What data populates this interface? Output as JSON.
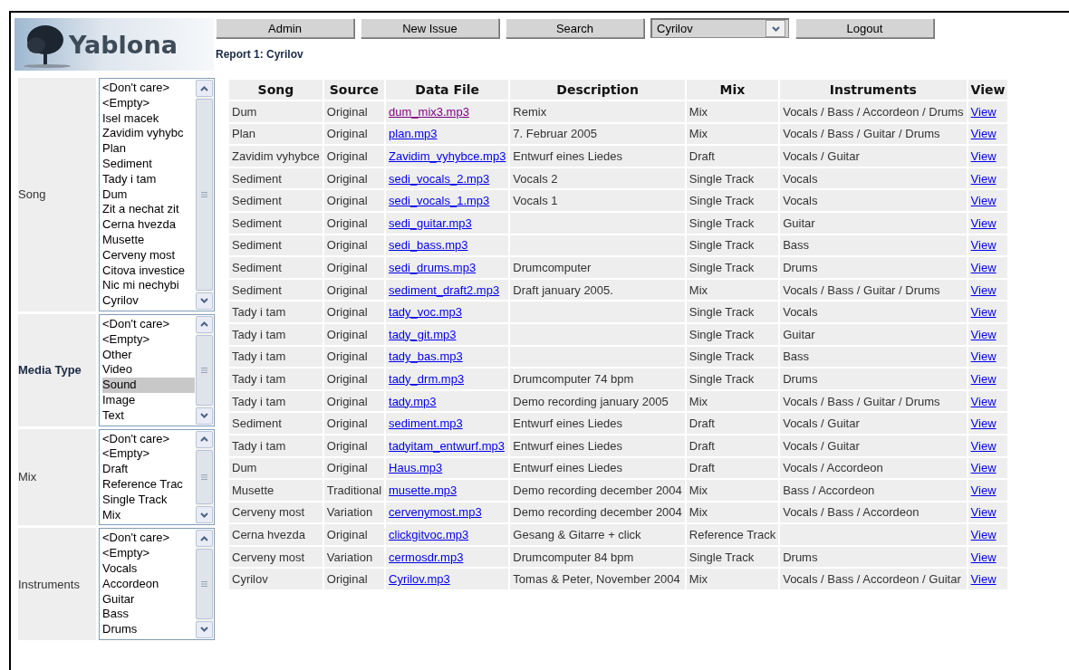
{
  "logo": {
    "text": "Yablona"
  },
  "nav": {
    "buttons": [
      "Admin",
      "New Issue",
      "Search"
    ],
    "user_select": {
      "value": "Cyrilov"
    },
    "logout": "Logout"
  },
  "report_title": "Report 1: Cyrilov",
  "filters": [
    {
      "label": "Song",
      "bold": false,
      "items": [
        {
          "text": "<Don't care>",
          "selected": false
        },
        {
          "text": "<Empty>",
          "selected": false
        },
        {
          "text": "Isel macek",
          "selected": false
        },
        {
          "text": "Zavidim vyhybc",
          "selected": false
        },
        {
          "text": "Plan",
          "selected": false
        },
        {
          "text": "Sediment",
          "selected": false
        },
        {
          "text": "Tady i tam",
          "selected": false
        },
        {
          "text": "Dum",
          "selected": false
        },
        {
          "text": "Zit a nechat zit",
          "selected": false
        },
        {
          "text": "Cerna hvezda",
          "selected": false
        },
        {
          "text": "Musette",
          "selected": false
        },
        {
          "text": "Cerveny most",
          "selected": false
        },
        {
          "text": "Citova investice",
          "selected": false
        },
        {
          "text": "Nic mi nechybi",
          "selected": false
        },
        {
          "text": "Cyrilov",
          "selected": false
        }
      ]
    },
    {
      "label": "Media Type",
      "bold": true,
      "items": [
        {
          "text": "<Don't care>",
          "selected": false
        },
        {
          "text": "<Empty>",
          "selected": false
        },
        {
          "text": "Other",
          "selected": false
        },
        {
          "text": "Video",
          "selected": false
        },
        {
          "text": "Sound",
          "selected": true
        },
        {
          "text": "Image",
          "selected": false
        },
        {
          "text": "Text",
          "selected": false
        }
      ]
    },
    {
      "label": "Mix",
      "bold": false,
      "items": [
        {
          "text": "<Don't care>",
          "selected": false
        },
        {
          "text": "<Empty>",
          "selected": false
        },
        {
          "text": "Draft",
          "selected": false
        },
        {
          "text": "Reference Trac",
          "selected": false
        },
        {
          "text": "Single Track",
          "selected": false
        },
        {
          "text": "Mix",
          "selected": false
        }
      ]
    },
    {
      "label": "Instruments",
      "bold": false,
      "items": [
        {
          "text": "<Don't care>",
          "selected": false
        },
        {
          "text": "<Empty>",
          "selected": false
        },
        {
          "text": "Vocals",
          "selected": false
        },
        {
          "text": "Accordeon",
          "selected": false
        },
        {
          "text": "Guitar",
          "selected": false
        },
        {
          "text": "Bass",
          "selected": false
        },
        {
          "text": "Drums",
          "selected": false
        }
      ]
    }
  ],
  "table": {
    "columns": [
      "Song",
      "Source",
      "Data File",
      "Description",
      "Mix",
      "Instruments",
      "View"
    ],
    "rows": [
      {
        "song": "Dum",
        "source": "Original",
        "file": "dum_mix3.mp3",
        "visited": true,
        "description": "Remix",
        "mix": "Mix",
        "instruments": "Vocals / Bass / Accordeon / Drums",
        "view": "View"
      },
      {
        "song": "Plan",
        "source": "Original",
        "file": "plan.mp3",
        "visited": false,
        "description": "7. Februar 2005",
        "mix": "Mix",
        "instruments": "Vocals / Bass / Guitar / Drums",
        "view": "View"
      },
      {
        "song": "Zavidim vyhybce",
        "source": "Original",
        "file": "Zavidim_vyhybce.mp3",
        "visited": false,
        "description": "Entwurf eines Liedes",
        "mix": "Draft",
        "instruments": "Vocals / Guitar",
        "view": "View"
      },
      {
        "song": "Sediment",
        "source": "Original",
        "file": "sedi_vocals_2.mp3",
        "visited": false,
        "description": "Vocals 2",
        "mix": "Single Track",
        "instruments": "Vocals",
        "view": "View"
      },
      {
        "song": "Sediment",
        "source": "Original",
        "file": "sedi_vocals_1.mp3",
        "visited": false,
        "description": "Vocals 1",
        "mix": "Single Track",
        "instruments": "Vocals",
        "view": "View"
      },
      {
        "song": "Sediment",
        "source": "Original",
        "file": "sedi_guitar.mp3",
        "visited": false,
        "mix": "Single Track",
        "instruments": "Guitar",
        "view": "View"
      },
      {
        "song": "Sediment",
        "source": "Original",
        "file": "sedi_bass.mp3",
        "visited": false,
        "mix": "Single Track",
        "instruments": "Bass",
        "view": "View"
      },
      {
        "song": "Sediment",
        "source": "Original",
        "file": "sedi_drums.mp3",
        "visited": false,
        "description": "Drumcomputer",
        "mix": "Single Track",
        "instruments": "Drums",
        "view": "View"
      },
      {
        "song": "Sediment",
        "source": "Original",
        "file": "sediment_draft2.mp3",
        "visited": false,
        "description": "Draft january 2005.",
        "mix": "Mix",
        "instruments": "Vocals / Bass / Guitar / Drums",
        "view": "View"
      },
      {
        "song": "Tady i tam",
        "source": "Original",
        "file": "tady_voc.mp3",
        "visited": false,
        "mix": "Single Track",
        "instruments": "Vocals",
        "view": "View"
      },
      {
        "song": "Tady i tam",
        "source": "Original",
        "file": "tady_git.mp3",
        "visited": false,
        "mix": "Single Track",
        "instruments": "Guitar",
        "view": "View"
      },
      {
        "song": "Tady i tam",
        "source": "Original",
        "file": "tady_bas.mp3",
        "visited": false,
        "mix": "Single Track",
        "instruments": "Bass",
        "view": "View"
      },
      {
        "song": "Tady i tam",
        "source": "Original",
        "file": "tady_drm.mp3",
        "visited": false,
        "description": "Drumcomputer 74 bpm",
        "mix": "Single Track",
        "instruments": "Drums",
        "view": "View"
      },
      {
        "song": "Tady i tam",
        "source": "Original",
        "file": "tady.mp3",
        "visited": false,
        "description": "Demo recording january 2005",
        "mix": "Mix",
        "instruments": "Vocals / Bass / Guitar / Drums",
        "view": "View"
      },
      {
        "song": "Sediment",
        "source": "Original",
        "file": "sediment.mp3",
        "visited": false,
        "description": "Entwurf eines Liedes",
        "mix": "Draft",
        "instruments": "Vocals / Guitar",
        "view": "View"
      },
      {
        "song": "Tady i tam",
        "source": "Original",
        "file": "tadyitam_entwurf.mp3",
        "visited": false,
        "description": "Entwurf eines Liedes",
        "mix": "Draft",
        "instruments": "Vocals / Guitar",
        "view": "View"
      },
      {
        "song": "Dum",
        "source": "Original",
        "file": "Haus.mp3",
        "visited": false,
        "description": "Entwurf eines Liedes",
        "mix": "Draft",
        "instruments": "Vocals / Accordeon",
        "view": "View"
      },
      {
        "song": "Musette",
        "source": "Traditional",
        "file": "musette.mp3",
        "visited": false,
        "description": "Demo recording december 2004",
        "mix": "Mix",
        "instruments": "Bass / Accordeon",
        "view": "View"
      },
      {
        "song": "Cerveny most",
        "source": "Variation",
        "file": "cervenymost.mp3",
        "visited": false,
        "description": "Demo recording december 2004",
        "mix": "Mix",
        "instruments": "Vocals / Bass / Accordeon",
        "view": "View"
      },
      {
        "song": "Cerna hvezda",
        "source": "Original",
        "file": "clickgitvoc.mp3",
        "visited": false,
        "description": "Gesang & Gitarre + click",
        "mix": "Reference Track",
        "view": "View"
      },
      {
        "song": "Cerveny most",
        "source": "Variation",
        "file": "cermosdr.mp3",
        "visited": false,
        "description": "Drumcomputer 84 bpm",
        "mix": "Single Track",
        "instruments": "Drums",
        "view": "View"
      },
      {
        "song": "Cyrilov",
        "source": "Original",
        "file": "Cyrilov.mp3",
        "visited": false,
        "description": "Tomas & Peter, November 2004",
        "mix": "Mix",
        "instruments": "Vocals / Bass / Accordeon / Guitar",
        "view": "View"
      }
    ]
  }
}
